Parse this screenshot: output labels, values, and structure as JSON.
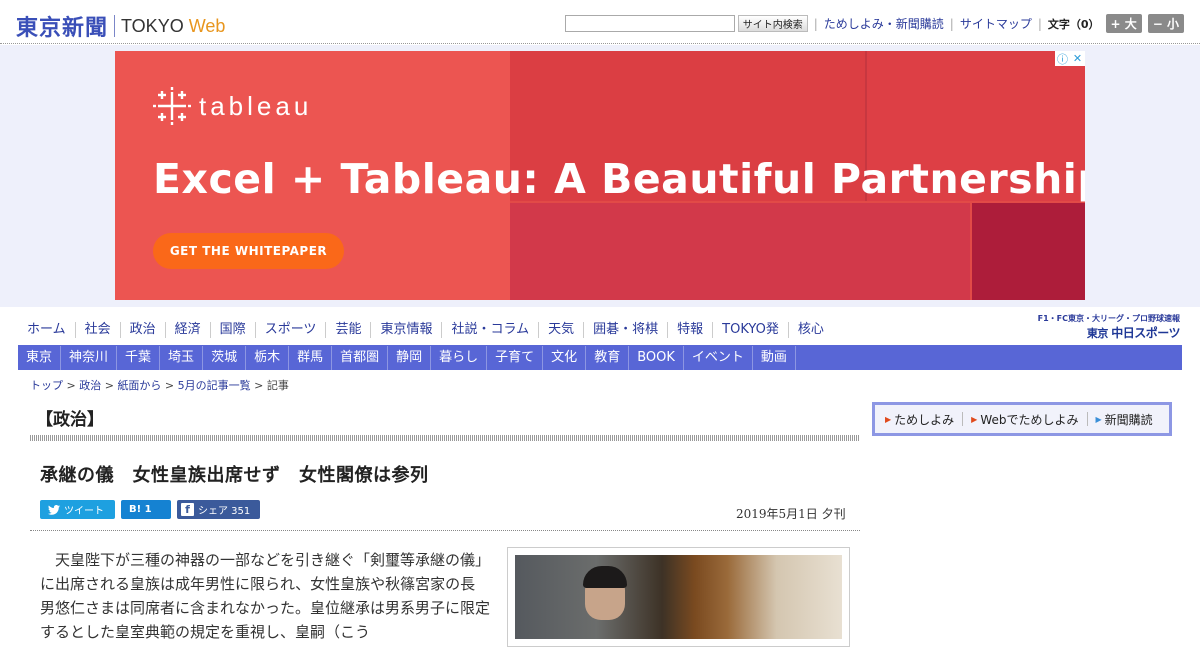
{
  "header": {
    "logo_jp": "東京新聞",
    "logo_en": "TOKYO",
    "logo_web": "Web",
    "search_button": "サイト内検索",
    "links": [
      "ためしよみ・新聞購読",
      "サイトマップ"
    ],
    "moji_label": "文字（0）",
    "size_large": "+ 大",
    "size_small": "− 小"
  },
  "ad": {
    "brand": "tableau",
    "headline": "Excel + Tableau: A Beautiful Partnership",
    "cta": "GET THE WHITEPAPER",
    "info_icon": "ⓘ",
    "close_icon": "✕"
  },
  "nav_primary": [
    "ホーム",
    "社会",
    "政治",
    "経済",
    "国際",
    "スポーツ",
    "芸能",
    "東京情報",
    "社説・コラム",
    "天気",
    "囲碁・将棋",
    "特報",
    "TOKYO発",
    "核心"
  ],
  "promo": {
    "top": "F1・FC東京・大リーグ・プロ野球速報",
    "prefix": "東京",
    "main": "中日スポーツ"
  },
  "nav_secondary": [
    "東京",
    "神奈川",
    "千葉",
    "埼玉",
    "茨城",
    "栃木",
    "群馬",
    "首都圏",
    "静岡",
    "暮らし",
    "子育て",
    "文化",
    "教育",
    "BOOK",
    "イベント",
    "動画"
  ],
  "breadcrumb": [
    "トップ",
    "政治",
    "紙面から",
    "5月の記事一覧",
    "記事"
  ],
  "article": {
    "section": "【政治】",
    "title": "承継の儀　女性皇族出席せず　女性閣僚は参列",
    "share_tweet": "ツイート",
    "share_hatena": "B! 1",
    "share_fb": "シェア 351",
    "date": "2019年5月1日 夕刊",
    "body": "天皇陛下が三種の神器の一部などを引き継ぐ「剣璽等承継の儀」に出席される皇族は成年男性に限られ、女性皇族や秋篠宮家の長男悠仁さまは同席者に含まれなかった。皇位継承は男系男子に限定するとした皇室典範の規定を重視し、皇嗣（こう"
  },
  "sidebar": {
    "links": [
      "ためしよみ",
      "Webでためしよみ",
      "新聞購読"
    ]
  }
}
